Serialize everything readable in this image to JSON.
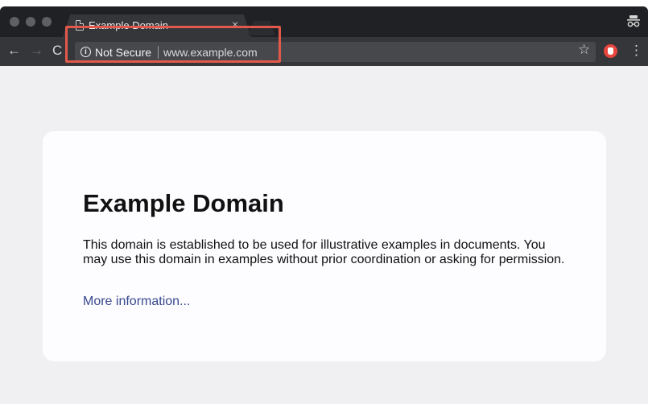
{
  "browser": {
    "tab": {
      "title": "Example Domain",
      "close_glyph": "×",
      "icon": "page-icon"
    },
    "nav": {
      "back_glyph": "←",
      "forward_glyph": "→",
      "reload_glyph": "C"
    },
    "omnibox": {
      "security_glyph": "i",
      "security_label": "Not Secure",
      "url": "www.example.com"
    },
    "star_glyph": "☆",
    "menu_glyph": "⋮",
    "incognito_icon": "incognito-icon",
    "extension_icon": "adblock-icon"
  },
  "page": {
    "heading": "Example Domain",
    "body": "This domain is established to be used for illustrative examples in documents. You may use this domain in examples without prior coordination or asking for permission.",
    "link": "More information..."
  },
  "colors": {
    "highlight": "#e2584a",
    "link": "#38488f",
    "toolbar": "#35363a",
    "tabstrip": "#202124"
  }
}
